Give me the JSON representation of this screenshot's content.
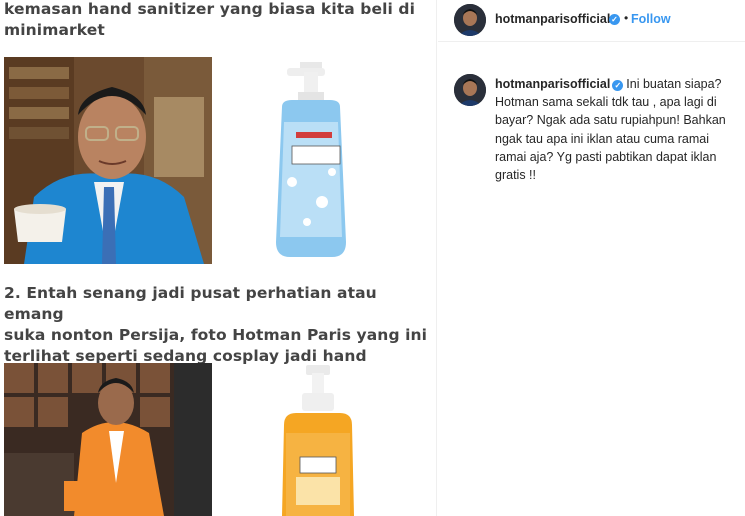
{
  "post": {
    "heading_top": "kemasan hand sanitizer yang biasa kita beli di\nminimarket",
    "heading_second": "2. Entah senang jadi pusat perhatian atau emang\nsuka nonton Persija, foto Hotman Paris yang ini\nterlihat seperti sedang cosplay jadi hand sanitizer"
  },
  "header": {
    "username": "hotmanparisofficial",
    "dot": "•",
    "follow_label": "Follow"
  },
  "caption": {
    "username": "hotmanparisofficial",
    "text": "Ini buatan siapa? Hotman sama sekali tdk tau , apa lagi di bayar? Ngak ada satu rupiahpun! Bahkan ngak tau apa ini iklan atau cuma ramai ramai aja? Yg pasti pabtikan dapat iklan gratis !!"
  },
  "colors": {
    "link_blue": "#3897f0",
    "text_dark": "#262626",
    "blue_suit": "#1e86d0",
    "orange_suit": "#f28b2c",
    "sanitizer_blue": "#8cc8ef",
    "sanitizer_orange": "#f5a623"
  },
  "icons": {
    "verified": "verified-badge-icon",
    "avatar": "profile-avatar"
  }
}
